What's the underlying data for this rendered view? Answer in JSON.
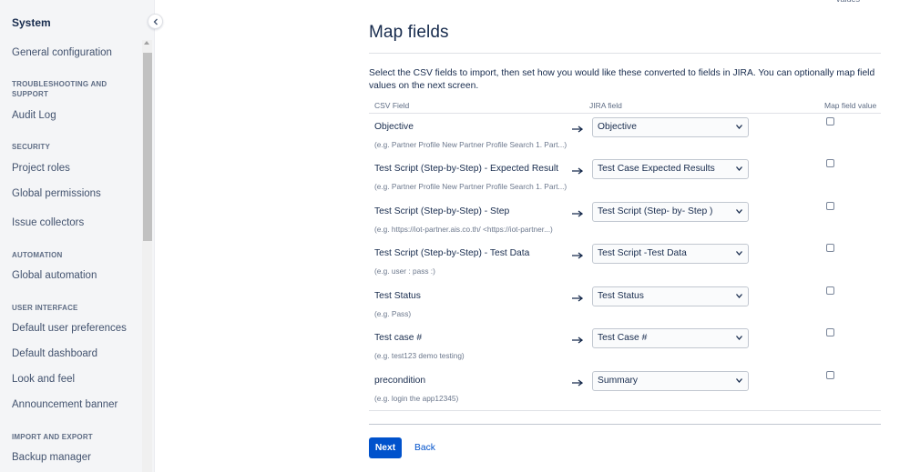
{
  "sidebar": {
    "title": "System",
    "general_configuration": "General configuration",
    "sections": {
      "troubleshooting": {
        "heading": "TROUBLESHOOTING AND SUPPORT",
        "items": [
          "Audit Log"
        ]
      },
      "security": {
        "heading": "SECURITY",
        "items": [
          "Project roles",
          "Global permissions",
          "Issue collectors"
        ]
      },
      "automation": {
        "heading": "AUTOMATION",
        "items": [
          "Global automation"
        ]
      },
      "user_interface": {
        "heading": "USER INTERFACE",
        "items": [
          "Default user preferences",
          "Default dashboard",
          "Look and feel",
          "Announcement banner"
        ]
      },
      "import_export": {
        "heading": "IMPORT AND EXPORT",
        "items": [
          "Backup manager"
        ]
      }
    }
  },
  "corner_text": "values",
  "main": {
    "title": "Map fields",
    "description": "Select the CSV fields to import, then set how you would like these converted to fields in JIRA. You can optionally map field values on the next screen.",
    "columns": {
      "csv_field": "CSV Field",
      "jira_field": "JIRA field",
      "map_value": "Map field value"
    },
    "rows": [
      {
        "csv": "Objective",
        "example": "(e.g. Partner Profile New Partner Profile Search 1. Part...)",
        "jira": "Objective",
        "map": false
      },
      {
        "csv": "Test Script (Step-by-Step) - Expected Result",
        "example": "(e.g. Partner Profile New Partner Profile Search 1. Part...)",
        "jira": "Test Case Expected Results",
        "map": false
      },
      {
        "csv": "Test Script (Step-by-Step) - Step",
        "example": "(e.g. https://iot-partner.ais.co.th/ <https://iot-partner...)",
        "jira": "Test Script (Step- by- Step )",
        "map": false
      },
      {
        "csv": "Test Script (Step-by-Step) - Test Data",
        "example": "(e.g. user : pass :)",
        "jira": "Test Script -Test Data",
        "map": false
      },
      {
        "csv": "Test Status",
        "example": "(e.g. Pass)",
        "jira": "Test Status",
        "map": false
      },
      {
        "csv": "Test case #",
        "example": "(e.g. test123 demo testing)",
        "jira": "Test Case #",
        "map": false
      },
      {
        "csv": "precondition",
        "example": "(e.g. login the app12345)",
        "jira": "Summary",
        "map": false
      }
    ],
    "buttons": {
      "next": "Next",
      "back": "Back"
    }
  }
}
